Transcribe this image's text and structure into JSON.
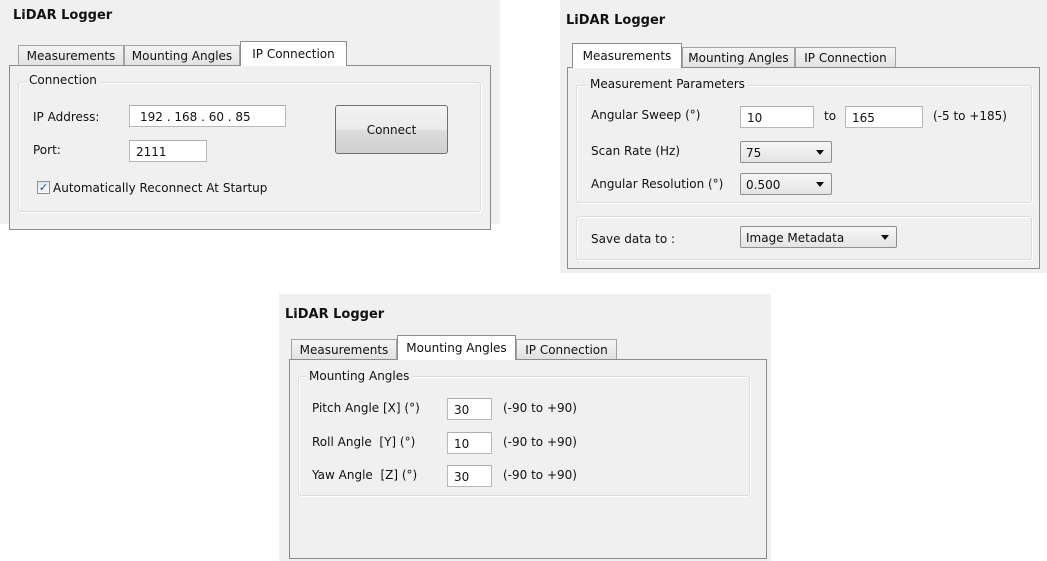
{
  "app_title": "LiDAR Logger",
  "tabs": {
    "measurements": "Measurements",
    "mounting": "Mounting Angles",
    "ip": "IP Connection"
  },
  "ip_window": {
    "group_label": "Connection",
    "ip_label": "IP Address:",
    "ip_value": "192 . 168 . 60 . 85",
    "port_label": "Port:",
    "port_value": "2111",
    "connect_button": "Connect",
    "auto_reconnect_label": "Automatically Reconnect At Startup",
    "auto_reconnect_checked": true
  },
  "measurements_window": {
    "group_label": "Measurement Parameters",
    "sweep_label": "Angular Sweep (°)",
    "sweep_from": "10",
    "sweep_to_label": "to",
    "sweep_to": "165",
    "sweep_range": "(-5 to +185)",
    "scan_rate_label": "Scan Rate (Hz)",
    "scan_rate_value": "75",
    "resolution_label": "Angular Resolution (°)",
    "resolution_value": "0.500",
    "save_label": "Save data to :",
    "save_value": "Image Metadata"
  },
  "mounting_window": {
    "group_label": "Mounting Angles",
    "pitch_label": "Pitch Angle [X] (°)",
    "pitch_value": "30",
    "pitch_range": "(-90 to +90)",
    "roll_label": "Roll Angle  [Y] (°)",
    "roll_value": "10",
    "roll_range": "(-90 to +90)",
    "yaw_label": "Yaw Angle  [Z] (°)",
    "yaw_value": "30",
    "yaw_range": "(-90 to +90)"
  }
}
